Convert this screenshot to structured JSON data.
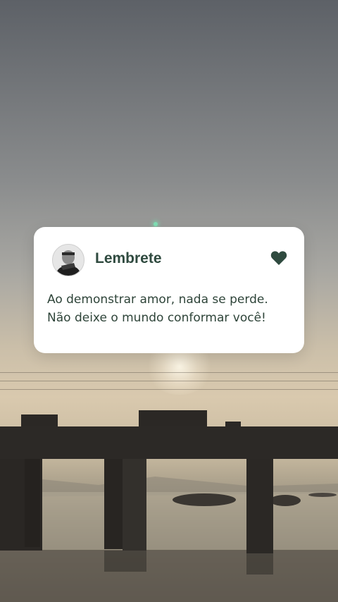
{
  "card": {
    "title": "Lembrete",
    "message_lines": [
      "Ao demonstrar amor, nada se perde.",
      "Não deixe o mundo conformar você!"
    ],
    "accent_color": "#2f4a3f",
    "icons": {
      "avatar": "person-photo-avatar",
      "favorite": "heart-icon"
    }
  },
  "background": {
    "scene": "sunset over river with bridge"
  }
}
